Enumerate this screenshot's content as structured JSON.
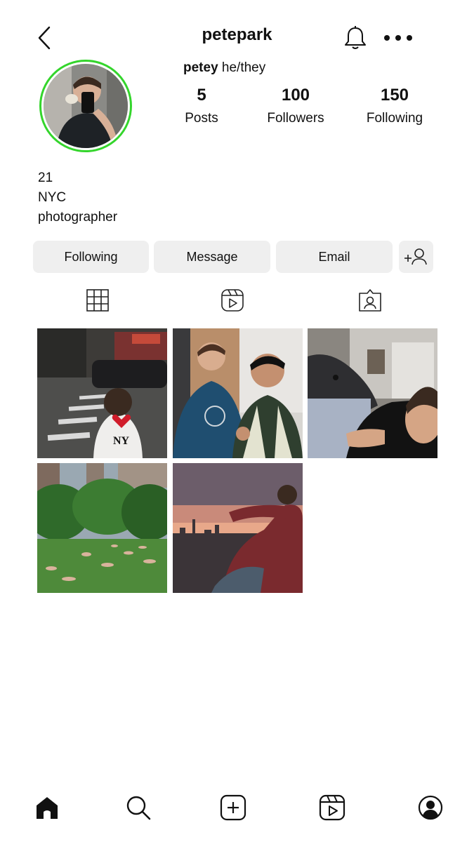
{
  "header": {
    "username": "petepark",
    "icons": [
      "chevron-left-icon",
      "bell-icon",
      "more-horizontal-icon"
    ]
  },
  "profile": {
    "display_name": "petey",
    "pronouns": "he/they",
    "ring_color": "#34d52c"
  },
  "stats": [
    {
      "value": "5",
      "label": "Posts"
    },
    {
      "value": "100",
      "label": "Followers"
    },
    {
      "value": "150",
      "label": "Following"
    }
  ],
  "bio": {
    "line1": "21",
    "line2": "NYC",
    "line3": "photographer"
  },
  "actions": {
    "following_label": "Following",
    "message_label": "Message",
    "email_label": "Email",
    "add_user_icon": "add-user-icon"
  },
  "tabs": [
    "grid-icon",
    "reels-icon",
    "tagged-icon"
  ],
  "posts": [
    {
      "description": "street-photo"
    },
    {
      "description": "friends-photo"
    },
    {
      "description": "dog-photo"
    },
    {
      "description": "park-photo"
    },
    {
      "description": "sunset-photo"
    }
  ],
  "bottom_nav": [
    "home-icon",
    "search-icon",
    "create-icon",
    "reels-icon",
    "profile-icon"
  ]
}
